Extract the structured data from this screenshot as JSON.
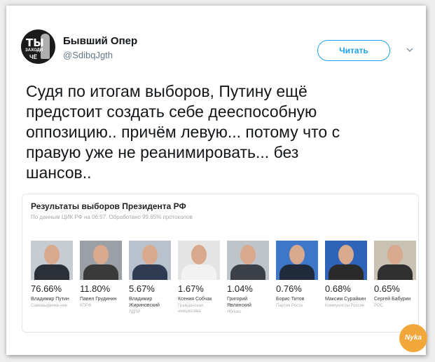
{
  "user": {
    "name": "Бывший Опер",
    "handle": "@SdibqJgth",
    "avatar_text": [
      "ТЫ",
      "ЗАХОДИ",
      "ЧЁ"
    ]
  },
  "follow_label": "Читать",
  "tweet_lines": [
    "Судя по итогам выборов, Путину ещё",
    "предстоит создать себе дееспособную",
    "оппозицию.. причём левую... потому что с",
    "правую уже не реанимировать... без",
    "шансов.."
  ],
  "embed": {
    "title": "Результаты выборов Президента РФ",
    "subtitle": "По данным ЦИК РФ на 06:57. Обработано 99.65% протоколов",
    "candidates": [
      {
        "percent": "76.66%",
        "name": "Владимир Путин",
        "party": "Самовыдвиже-ние",
        "photo_bg": "#c7cbd2",
        "suit": "#2a2f38"
      },
      {
        "percent": "11.80%",
        "name": "Павел Грудинин",
        "party": "КПРФ",
        "photo_bg": "#9aa0a6",
        "suit": "#3a3a3a"
      },
      {
        "percent": "5.67%",
        "name": "Владимир Жириновский",
        "party": "ЛДПР",
        "photo_bg": "#b9c2cc",
        "suit": "#2f3b52"
      },
      {
        "percent": "1.67%",
        "name": "Ксения Собчак",
        "party": "Гражданская инициатива",
        "photo_bg": "#e4e4e4",
        "suit": "#f2f2f2"
      },
      {
        "percent": "1.04%",
        "name": "Григорий Явлинский",
        "party": "Яблоко",
        "photo_bg": "#bfc4c8",
        "suit": "#3c4048"
      },
      {
        "percent": "0.76%",
        "name": "Борис Титов",
        "party": "Партия Роста",
        "photo_bg": "#3f78c9",
        "suit": "#1f2a3a"
      },
      {
        "percent": "0.68%",
        "name": "Максим Сурайкин",
        "party": "Коммунисты России",
        "photo_bg": "#2e63b8",
        "suit": "#2a2a2a"
      },
      {
        "percent": "0.65%",
        "name": "Сергей Бабурин",
        "party": "РОС",
        "photo_bg": "#c9c2b2",
        "suit": "#303030"
      }
    ]
  },
  "watermark": "Nyka",
  "colors": {
    "accent": "#1da1f2",
    "text": "#14171a",
    "muted": "#657786"
  }
}
